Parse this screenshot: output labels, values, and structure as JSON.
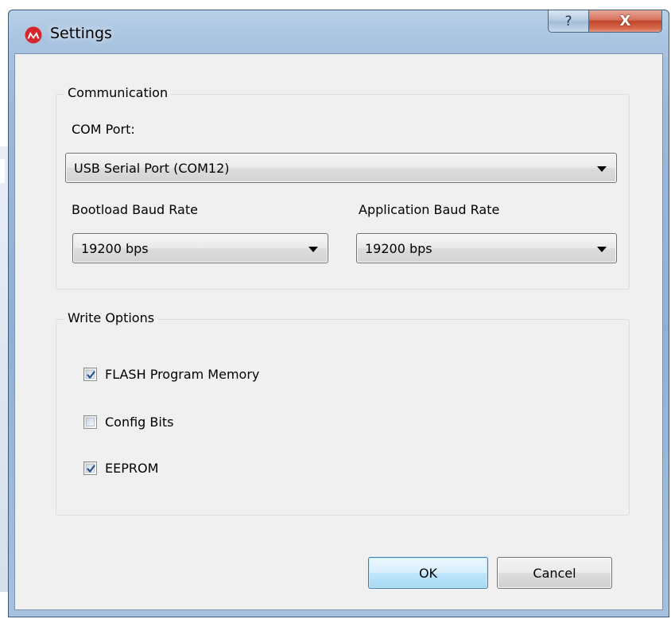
{
  "window": {
    "title": "Settings",
    "help_label": "?",
    "close_label": "X"
  },
  "communication": {
    "group_label": "Communication",
    "com_port_label": "COM Port:",
    "com_port_value": "USB Serial Port (COM12)",
    "bootload_label": "Bootload Baud Rate",
    "bootload_value": "19200 bps",
    "application_label": "Application Baud Rate",
    "application_value": "19200 bps"
  },
  "write_options": {
    "group_label": "Write Options",
    "options": [
      {
        "label": "FLASH Program Memory",
        "checked": true
      },
      {
        "label": "Config Bits",
        "checked": false
      },
      {
        "label": "EEPROM",
        "checked": true
      }
    ]
  },
  "buttons": {
    "ok": "OK",
    "cancel": "Cancel"
  },
  "colors": {
    "logo_red": "#d7262b",
    "check_blue": "#2b4f8c"
  }
}
